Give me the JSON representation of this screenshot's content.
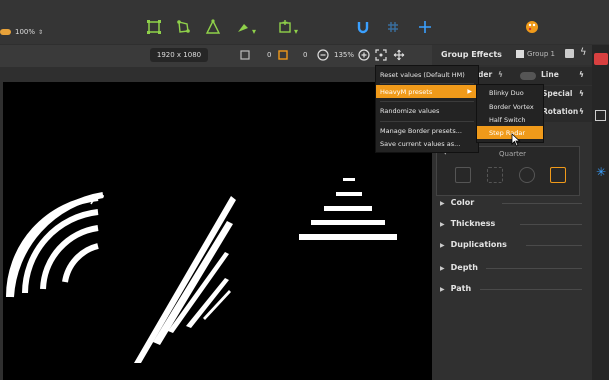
{
  "toolbar": {
    "zoom_value": "100%",
    "icons": [
      "rect-select-icon",
      "node-edit-icon",
      "triangle-icon",
      "pen-icon",
      "crop-icon",
      "magnet-icon",
      "grid-icon",
      "crosshair-icon",
      "palette-icon"
    ]
  },
  "subbar": {
    "resolution": "1920 x 1080",
    "field_a": "0",
    "field_b": "0",
    "zoom": "135%"
  },
  "panel": {
    "title": "Group Effects",
    "group_label": "Group 1",
    "tabs_row1": [
      "der",
      "Line"
    ],
    "tabs_row2": [
      "Special",
      "Rotation"
    ],
    "quarter_label": "Quarter",
    "sections": [
      "Color",
      "Thickness",
      "Duplications",
      "Depth",
      "Path"
    ]
  },
  "menu": {
    "items": [
      "Reset values (Default HM)",
      "HeavyM presets",
      "Randomize values",
      "Manage Border presets...",
      "Save current values as..."
    ],
    "submenu": [
      "Blinky Duo",
      "Border Vortex",
      "Half Switch",
      "Step Radar"
    ]
  },
  "colors": {
    "accent": "#f09a1a",
    "toolbar_icon": "#8fd14a",
    "blue_icon": "#3aa0ff"
  }
}
